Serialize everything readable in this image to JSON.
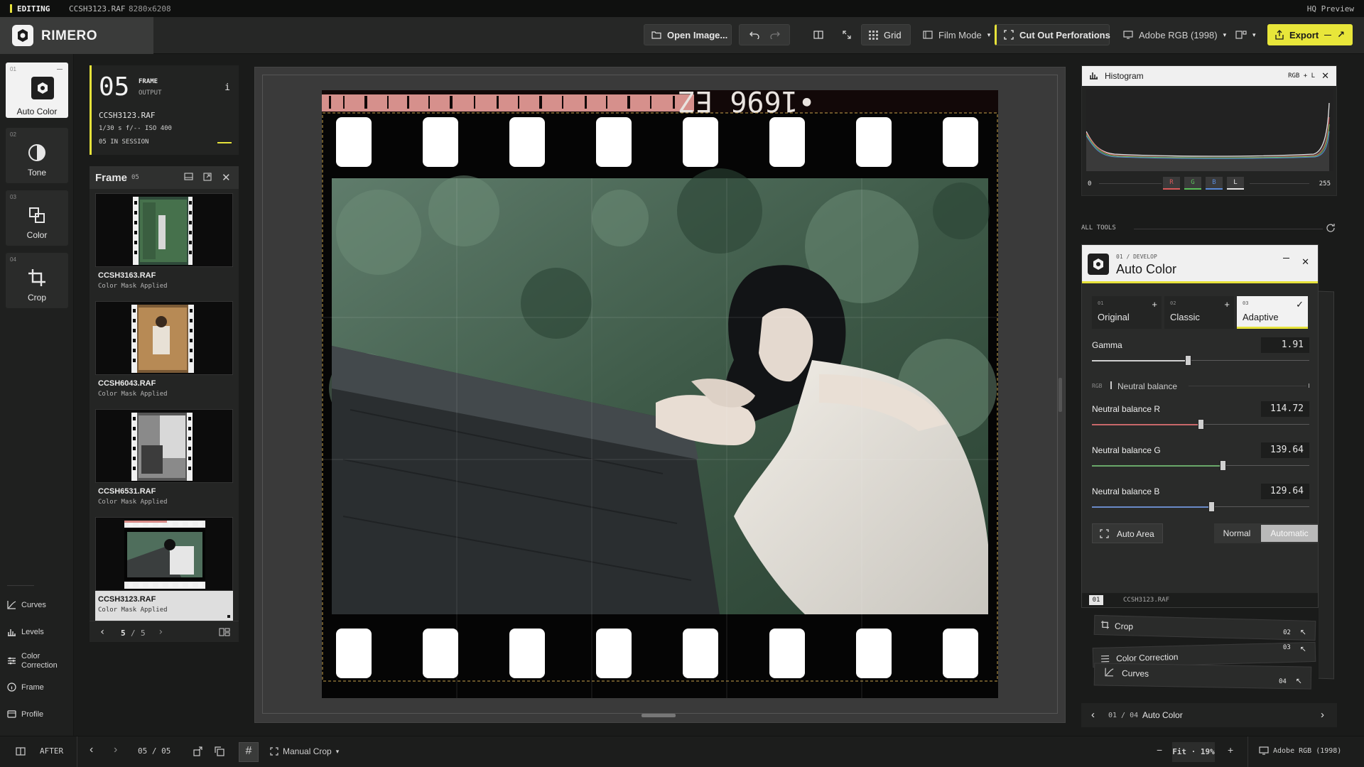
{
  "status_bar": {
    "mode": "EDITING",
    "file": "CCSH3123.RAF",
    "dimensions": "8280x6208",
    "right": "HQ Preview"
  },
  "app": {
    "name": "RIMERO"
  },
  "header": {
    "open_image": "Open Image...",
    "grid": "Grid",
    "film_mode": "Film Mode",
    "cut_perforations": "Cut Out Perforations",
    "color_space": "Adobe RGB (1998)",
    "export": "Export"
  },
  "rail": {
    "tools": [
      {
        "num": "01",
        "label": "Auto Color"
      },
      {
        "num": "02",
        "label": "Tone"
      },
      {
        "num": "03",
        "label": "Color"
      },
      {
        "num": "04",
        "label": "Crop"
      }
    ],
    "links": [
      "Curves",
      "Levels",
      "Color",
      "Correction",
      "Frame",
      "Profile"
    ]
  },
  "frame_info": {
    "number": "05",
    "label1": "FRAME",
    "label2": "OUTPUT",
    "info_icon": "i",
    "file": "CCSH3123.RAF",
    "exposure": "1/30 s f/-- ISO 400",
    "session": "05 IN SESSION"
  },
  "filmstrip": {
    "title": "Frame",
    "count": "05",
    "items": [
      {
        "name": "CCSH3163.RAF",
        "status": "Color Mask Applied"
      },
      {
        "name": "CCSH6043.RAF",
        "status": "Color Mask Applied"
      },
      {
        "name": "CCSH6531.RAF",
        "status": "Color Mask Applied"
      },
      {
        "name": "CCSH3123.RAF",
        "status": "Color Mask Applied"
      }
    ],
    "pager": {
      "current": "5",
      "sep": "/",
      "total": "5"
    }
  },
  "film_edge": {
    "code": "•1696 EZ"
  },
  "histogram": {
    "title": "Histogram",
    "mode": "RGB + L",
    "min": "0",
    "max": "255",
    "channels": [
      "R",
      "G",
      "B",
      "L"
    ]
  },
  "tools_header": "ALL TOOLS",
  "auto_color": {
    "breadcrumb": "01 / DEVELOP",
    "title": "Auto Color",
    "presets": [
      {
        "num": "01",
        "label": "Original",
        "mark": "+"
      },
      {
        "num": "02",
        "label": "Classic",
        "mark": "+"
      },
      {
        "num": "03",
        "label": "Adaptive",
        "mark": "✓"
      }
    ],
    "gamma": {
      "label": "Gamma",
      "value": "1.91",
      "pos": 0.44
    },
    "neutral_section": {
      "prefix": "RGB",
      "label": "Neutral balance"
    },
    "nb_r": {
      "label": "Neutral balance R",
      "value": "114.72",
      "pos": 0.5
    },
    "nb_g": {
      "label": "Neutral balance G",
      "value": "139.64",
      "pos": 0.6
    },
    "nb_b": {
      "label": "Neutral balance B",
      "value": "129.64",
      "pos": 0.55
    },
    "auto_area": "Auto Area",
    "mode_normal": "Normal",
    "mode_auto": "Automatic",
    "footer_num": "01",
    "footer_file": "CCSH3123.RAF"
  },
  "stack": [
    {
      "label": "Crop",
      "num": "02"
    },
    {
      "label": "Color Correction",
      "num": "03"
    },
    {
      "label": "Curves",
      "num": "04"
    }
  ],
  "right_footer": {
    "index": "01 / 04",
    "name": "Auto Color"
  },
  "bottom": {
    "after": "AFTER",
    "frame": "05 / 05",
    "crop": "Manual Crop",
    "zoom": "Fit · 19%",
    "profile": "Adobe RGB (1998)"
  }
}
